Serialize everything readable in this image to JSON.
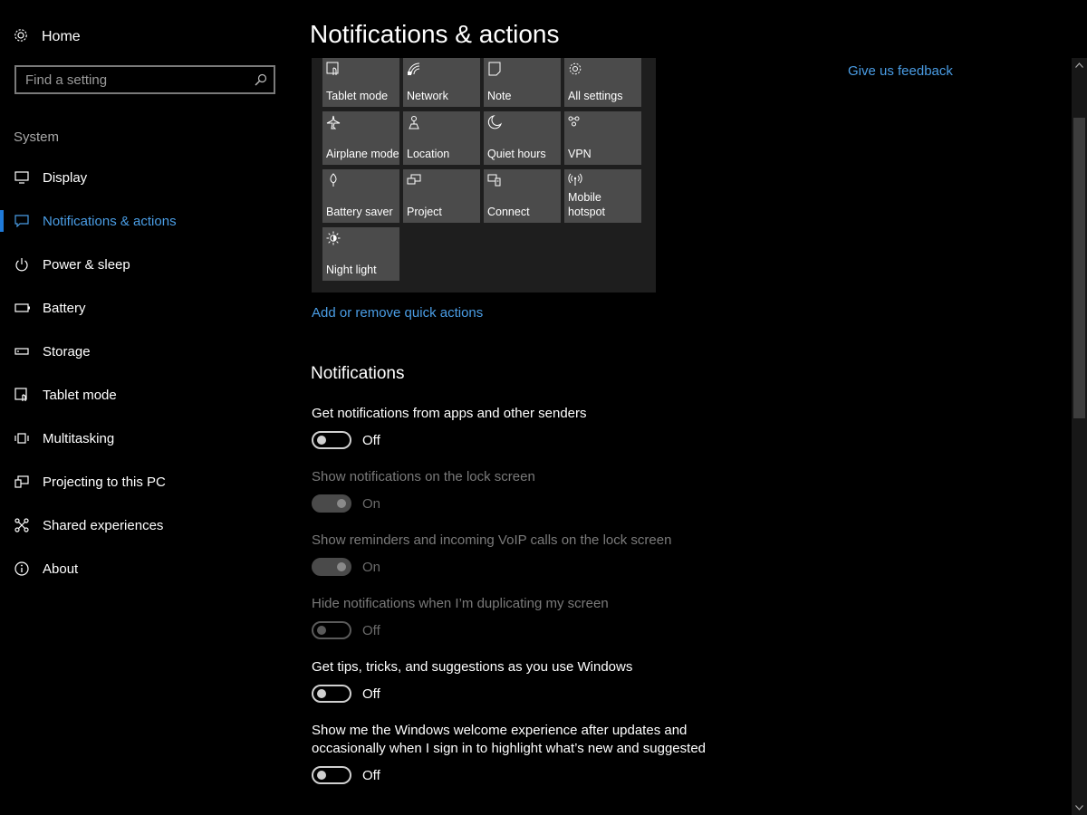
{
  "sidebar": {
    "home_label": "Home",
    "search_placeholder": "Find a setting",
    "section_label": "System",
    "items": [
      {
        "label": "Display",
        "icon": "monitor-icon"
      },
      {
        "label": "Notifications & actions",
        "icon": "message-icon",
        "active": true
      },
      {
        "label": "Power & sleep",
        "icon": "power-icon"
      },
      {
        "label": "Battery",
        "icon": "battery-icon"
      },
      {
        "label": "Storage",
        "icon": "storage-icon"
      },
      {
        "label": "Tablet mode",
        "icon": "tablet-mode-icon"
      },
      {
        "label": "Multitasking",
        "icon": "multitasking-icon"
      },
      {
        "label": "Projecting to this PC",
        "icon": "projecting-icon"
      },
      {
        "label": "Shared experiences",
        "icon": "shared-experiences-icon"
      },
      {
        "label": "About",
        "icon": "info-icon"
      }
    ]
  },
  "main": {
    "title": "Notifications & actions",
    "feedback_link": "Give us feedback",
    "quick_actions": [
      {
        "label": "Tablet mode",
        "icon": "tablet-mode-icon"
      },
      {
        "label": "Network",
        "icon": "network-icon"
      },
      {
        "label": "Note",
        "icon": "note-icon"
      },
      {
        "label": "All settings",
        "icon": "gear-icon"
      },
      {
        "label": "Airplane mode",
        "icon": "airplane-icon"
      },
      {
        "label": "Location",
        "icon": "location-icon"
      },
      {
        "label": "Quiet hours",
        "icon": "moon-icon"
      },
      {
        "label": "VPN",
        "icon": "vpn-icon"
      },
      {
        "label": "Battery saver",
        "icon": "battery-saver-icon"
      },
      {
        "label": "Project",
        "icon": "project-icon"
      },
      {
        "label": "Connect",
        "icon": "connect-icon"
      },
      {
        "label": "Mobile\nhotspot",
        "icon": "mobile-hotspot-icon"
      },
      {
        "label": "Night light",
        "icon": "brightness-icon"
      }
    ],
    "add_remove_link": "Add or remove quick actions",
    "notifications_title": "Notifications",
    "settings": [
      {
        "desc": "Get notifications from apps and other senders",
        "state": "Off",
        "enabled": true
      },
      {
        "desc": "Show notifications on the lock screen",
        "state": "On",
        "enabled": false
      },
      {
        "desc": "Show reminders and incoming VoIP calls on the lock screen",
        "state": "On",
        "enabled": false
      },
      {
        "desc": "Hide notifications when I’m duplicating my screen",
        "state": "Off",
        "enabled": false
      },
      {
        "desc": "Get tips, tricks, and suggestions as you use Windows",
        "state": "Off",
        "enabled": true
      },
      {
        "desc": "Show me the Windows welcome experience after updates and occasionally when I sign in to highlight what’s new and suggested",
        "state": "Off",
        "enabled": true
      }
    ]
  },
  "colors": {
    "accent": "#4a9de5",
    "background": "#000000",
    "tile": "#4b4b4b"
  }
}
